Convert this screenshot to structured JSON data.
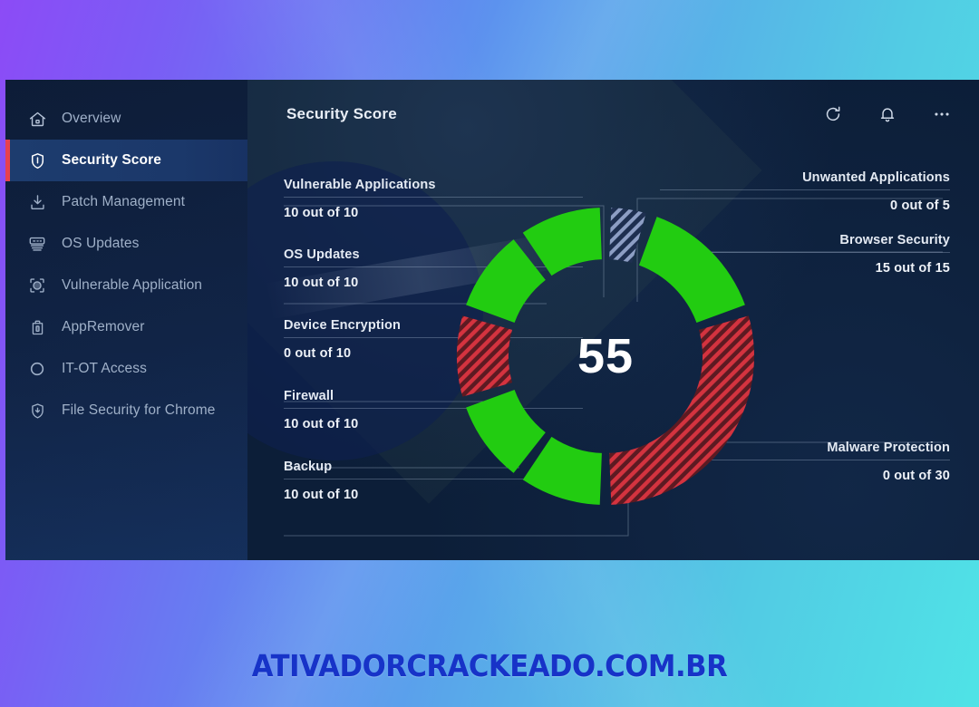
{
  "sidebar": {
    "items": [
      {
        "label": "Overview",
        "icon": "home-icon",
        "active": false
      },
      {
        "label": "Security Score",
        "icon": "shield-icon",
        "active": true
      },
      {
        "label": "Patch Management",
        "icon": "download-icon",
        "active": false
      },
      {
        "label": "OS Updates",
        "icon": "server-icon",
        "active": false
      },
      {
        "label": "Vulnerable Application",
        "icon": "scan-target-icon",
        "active": false
      },
      {
        "label": "AppRemover",
        "icon": "trash-icon",
        "active": false
      },
      {
        "label": "IT-OT Access",
        "icon": "circle-icon",
        "active": false
      },
      {
        "label": "File Security for Chrome",
        "icon": "shield-down-icon",
        "active": false
      }
    ]
  },
  "header": {
    "title": "Security Score",
    "actions": [
      {
        "name": "refresh-icon",
        "label": "Refresh"
      },
      {
        "name": "notifications-icon",
        "label": "Notifications"
      },
      {
        "name": "more-options-icon",
        "label": "More options"
      }
    ]
  },
  "score": {
    "value": "55"
  },
  "stats_left": [
    {
      "name": "Vulnerable Applications",
      "value": "10 out of 10"
    },
    {
      "name": "OS Updates",
      "value": "10 out of 10"
    },
    {
      "name": "Device Encryption",
      "value": "0 out of 10"
    },
    {
      "name": "Firewall",
      "value": "10 out of 10"
    },
    {
      "name": "Backup",
      "value": "10 out of 10"
    }
  ],
  "stats_right": [
    {
      "name": "Unwanted Applications",
      "value": "0 out of 5"
    },
    {
      "name": "Browser Security",
      "value": "15 out of 15"
    },
    {
      "name": "Malware Protection",
      "value": "0 out of 30"
    }
  ],
  "colors": {
    "good": "#22cc11",
    "bad_base": "#5c1a22",
    "bad_stripe": "#d4333f",
    "neutral_base": "#1e2f50",
    "neutral_stripe": "#8d9ec4",
    "accent": "#e8414f",
    "panel": "#0c1e38",
    "sidebar": "#13284d",
    "sidebar_active": "#1d3c6e",
    "gradient_start": "#8c4bf6",
    "gradient_end": "#4fe3e6",
    "watermark": "#1733c8"
  },
  "chart_data": {
    "type": "pie",
    "title": "Security Score",
    "center_label": "55",
    "total_score": 55,
    "max_score": 100,
    "legend_position": "sides",
    "categories": [
      "Unwanted Applications",
      "Browser Security",
      "Malware Protection",
      "Backup",
      "Firewall",
      "Device Encryption",
      "OS Updates",
      "Vulnerable Applications"
    ],
    "values": [
      5,
      15,
      30,
      10,
      10,
      10,
      10,
      10
    ],
    "scores": [
      0,
      15,
      0,
      10,
      10,
      0,
      10,
      10
    ],
    "segments": [
      {
        "label": "Unwanted Applications",
        "score": 0,
        "max": 5,
        "state": "empty",
        "fill": "striped-neutral",
        "start_deg": 0,
        "end_deg": 18
      },
      {
        "label": "Browser Security",
        "score": 15,
        "max": 15,
        "state": "full",
        "fill": "solid-green",
        "start_deg": 18,
        "end_deg": 72
      },
      {
        "label": "Malware Protection",
        "score": 0,
        "max": 30,
        "state": "empty",
        "fill": "striped-red",
        "start_deg": 72,
        "end_deg": 180
      },
      {
        "label": "Backup",
        "score": 10,
        "max": 10,
        "state": "full",
        "fill": "solid-green",
        "start_deg": 180,
        "end_deg": 216
      },
      {
        "label": "Firewall",
        "score": 10,
        "max": 10,
        "state": "full",
        "fill": "solid-green",
        "start_deg": 216,
        "end_deg": 252
      },
      {
        "label": "Device Encryption",
        "score": 0,
        "max": 10,
        "state": "empty",
        "fill": "striped-red",
        "start_deg": 252,
        "end_deg": 288
      },
      {
        "label": "OS Updates",
        "score": 10,
        "max": 10,
        "state": "full",
        "fill": "solid-green",
        "start_deg": 288,
        "end_deg": 324
      },
      {
        "label": "Vulnerable Applications",
        "score": 10,
        "max": 10,
        "state": "full",
        "fill": "solid-green",
        "start_deg": 324,
        "end_deg": 360
      }
    ],
    "xlabel": "",
    "ylabel": ""
  },
  "watermark": {
    "text": "ATIVADORCRACKEADO.COM.BR"
  }
}
